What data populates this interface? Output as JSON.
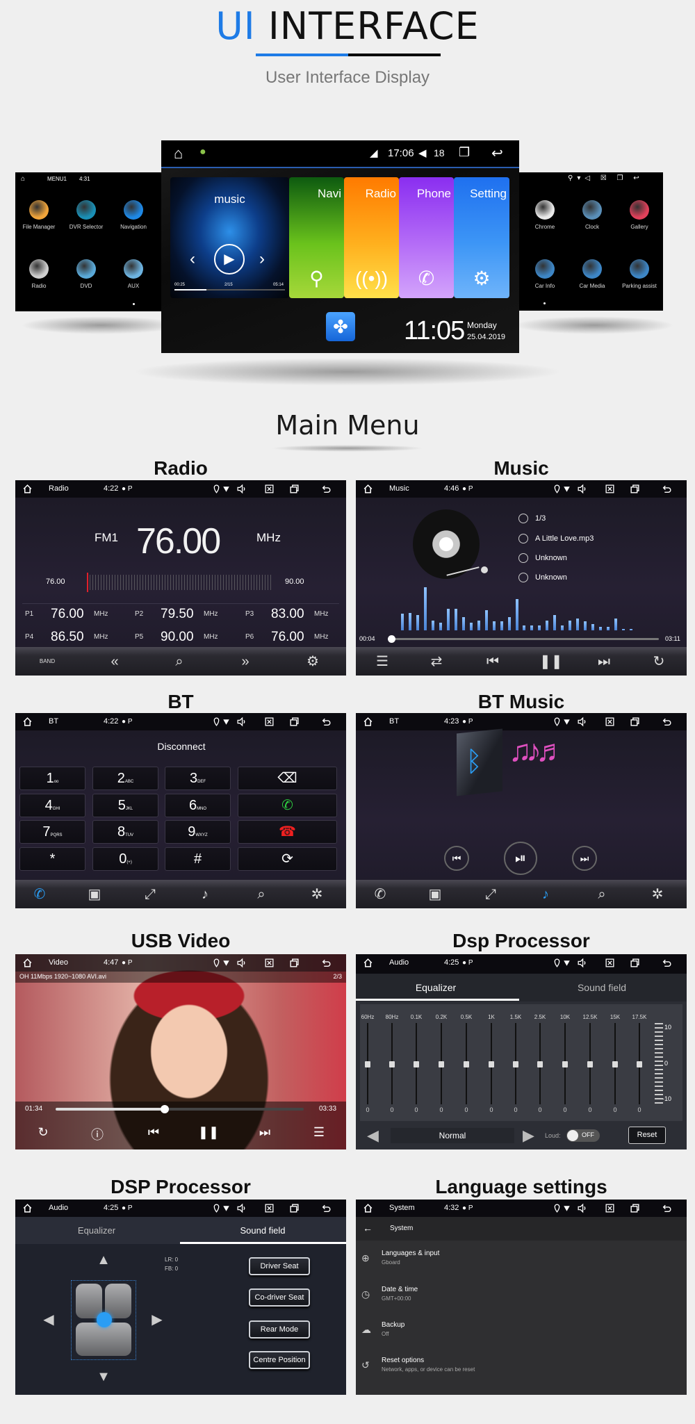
{
  "header": {
    "title_accent": "UI",
    "title_rest": "INTERFACE",
    "subtitle": "User Interface Display"
  },
  "colors": {
    "accent": "#1e7be6",
    "navi": "#5bb82a",
    "radio": "#ff8a00",
    "phone": "#a14cf5",
    "setting": "#2f8cf5"
  },
  "hero": {
    "left": {
      "status": {
        "title": "MENU1",
        "time": "4:31"
      },
      "apps": [
        {
          "label": "File Manager",
          "icon": "folder-icon",
          "color": "#f0a43a"
        },
        {
          "label": "DVR Selector",
          "icon": "camera-icon",
          "color": "#1a8fb5"
        },
        {
          "label": "Navigation",
          "icon": "navigation-arrow-icon",
          "color": "#1e88e5"
        },
        {
          "label": "Radio",
          "icon": "radio-icon",
          "color": "#cfcfcf"
        },
        {
          "label": "DVD",
          "icon": "disc-icon",
          "color": "#5aa9d8"
        },
        {
          "label": "AUX",
          "icon": "aux-icon",
          "color": "#6db3e0"
        }
      ]
    },
    "center": {
      "time": "17:06",
      "volume": "18",
      "music": {
        "label": "music",
        "elapsed": "00:25",
        "track": "2/15",
        "total": "05:14",
        "progress": 0.29
      },
      "tiles": [
        {
          "label": "Navi",
          "icon": "location-pin-icon"
        },
        {
          "label": "Radio",
          "icon": "antenna-icon"
        },
        {
          "label": "Phone",
          "icon": "phone-icon"
        },
        {
          "label": "Setting",
          "icon": "car-settings-icon"
        }
      ],
      "clock": "11:05",
      "day": "Monday",
      "date": "25.04.2019"
    },
    "right": {
      "apps": [
        {
          "label": "Chrome",
          "icon": "chrome-icon",
          "color": "#e9e9e9"
        },
        {
          "label": "Clock",
          "icon": "clock-icon",
          "color": "#5a8fb8"
        },
        {
          "label": "Gallery",
          "icon": "gallery-icon",
          "color": "#e0405a"
        },
        {
          "label": "Car Info",
          "icon": "car-icon",
          "color": "#3d86c6"
        },
        {
          "label": "Car Media",
          "icon": "car-icon",
          "color": "#3d86c6"
        },
        {
          "label": "Parking assist",
          "icon": "car-icon",
          "color": "#3d86c6"
        }
      ]
    }
  },
  "main_menu": "Main Menu",
  "radio": {
    "section": "Radio",
    "status": {
      "title": "Radio",
      "time": "4:22"
    },
    "band": "FM1",
    "frequency": "76.00",
    "unit": "MHz",
    "scale_min": "76.00",
    "scale_max": "90.00",
    "presets": [
      {
        "id": "P1",
        "value": "76.00",
        "unit": "MHz"
      },
      {
        "id": "P2",
        "value": "79.50",
        "unit": "MHz"
      },
      {
        "id": "P3",
        "value": "83.00",
        "unit": "MHz"
      },
      {
        "id": "P4",
        "value": "86.50",
        "unit": "MHz"
      },
      {
        "id": "P5",
        "value": "90.00",
        "unit": "MHz"
      },
      {
        "id": "P6",
        "value": "76.00",
        "unit": "MHz"
      }
    ],
    "band_button": "BAND"
  },
  "music": {
    "section": "Music",
    "status": {
      "title": "Music",
      "time": "4:46"
    },
    "info": [
      {
        "icon": "disc-icon",
        "text": "1/3"
      },
      {
        "icon": "music-note-icon",
        "text": "A Little Love.mp3"
      },
      {
        "icon": "artist-icon",
        "text": "Unknown"
      },
      {
        "icon": "album-icon",
        "text": "Unknown"
      }
    ],
    "elapsed": "00:04",
    "total": "03:11",
    "progress": 0.01,
    "spectrum": [
      0.38,
      0.4,
      0.36,
      1,
      0.23,
      0.17,
      0.5,
      0.5,
      0.31,
      0.17,
      0.23,
      0.46,
      0.21,
      0.21,
      0.31,
      0.72,
      0.12,
      0.12,
      0.12,
      0.23,
      0.36,
      0.12,
      0.23,
      0.27,
      0.21,
      0.15,
      0.08,
      0.08,
      0.27,
      0.02,
      0.02
    ]
  },
  "bt": {
    "section": "BT",
    "status": {
      "title": "BT",
      "time": "4:22"
    },
    "state": "Disconnect",
    "keys": [
      {
        "d": "1",
        "s": "oo"
      },
      {
        "d": "2",
        "s": "ABC"
      },
      {
        "d": "3",
        "s": "DEF"
      },
      {
        "d": "4",
        "s": "GHI"
      },
      {
        "d": "5",
        "s": "JKL"
      },
      {
        "d": "6",
        "s": "MNO"
      },
      {
        "d": "7",
        "s": "PQRS"
      },
      {
        "d": "8",
        "s": "TUV"
      },
      {
        "d": "9",
        "s": "WXYZ"
      },
      {
        "d": "*",
        "s": ""
      },
      {
        "d": "0",
        "s": "(+)"
      },
      {
        "d": "#",
        "s": ""
      }
    ]
  },
  "bt_music": {
    "section": "BT Music",
    "status": {
      "title": "BT",
      "time": "4:23"
    }
  },
  "usb_video": {
    "section": "USB Video",
    "status": {
      "title": "Video",
      "time": "4:47"
    },
    "file": "OH 11Mbps 1920~1080 AVI.avi",
    "index": "2/3",
    "elapsed": "01:34",
    "total": "03:33",
    "progress": 0.44
  },
  "dsp_eq": {
    "section": "Dsp Processor",
    "status": {
      "title": "Audio",
      "time": "4:25"
    },
    "tabs": [
      "Equalizer",
      "Sound field"
    ],
    "bands": [
      {
        "label": "60Hz",
        "value": 0
      },
      {
        "label": "80Hz",
        "value": 0
      },
      {
        "label": "0.1K",
        "value": 0
      },
      {
        "label": "0.2K",
        "value": 0
      },
      {
        "label": "0.5K",
        "value": 0
      },
      {
        "label": "1K",
        "value": 0
      },
      {
        "label": "1.5K",
        "value": 0
      },
      {
        "label": "2.5K",
        "value": 0
      },
      {
        "label": "10K",
        "value": 0
      },
      {
        "label": "12.5K",
        "value": 0
      },
      {
        "label": "15K",
        "value": 0
      },
      {
        "label": "17.5K",
        "value": 0
      }
    ],
    "scale": [
      "10",
      "0",
      "-10"
    ],
    "preset": "Normal",
    "loud_label": "Loud:",
    "loud_state": "OFF",
    "reset": "Reset"
  },
  "dsp_sf": {
    "section": "DSP Processor",
    "status": {
      "title": "Audio",
      "time": "4:25"
    },
    "tabs": [
      "Equalizer",
      "Sound field"
    ],
    "lr": "LR: 0",
    "fb": "FB: 0",
    "buttons": [
      "Driver Seat",
      "Co-driver Seat",
      "Rear Mode",
      "Centre Position"
    ]
  },
  "language": {
    "section": "Language settings",
    "status": {
      "title": "System",
      "time": "4:32"
    },
    "header": "System",
    "items": [
      {
        "icon": "globe-icon",
        "title": "Languages & input",
        "sub": "Gboard"
      },
      {
        "icon": "clock-icon",
        "title": "Date & time",
        "sub": "GMT+00:00"
      },
      {
        "icon": "backup-icon",
        "title": "Backup",
        "sub": "Off"
      },
      {
        "icon": "reset-icon",
        "title": "Reset options",
        "sub": "Network, apps, or device can be reset"
      }
    ]
  }
}
